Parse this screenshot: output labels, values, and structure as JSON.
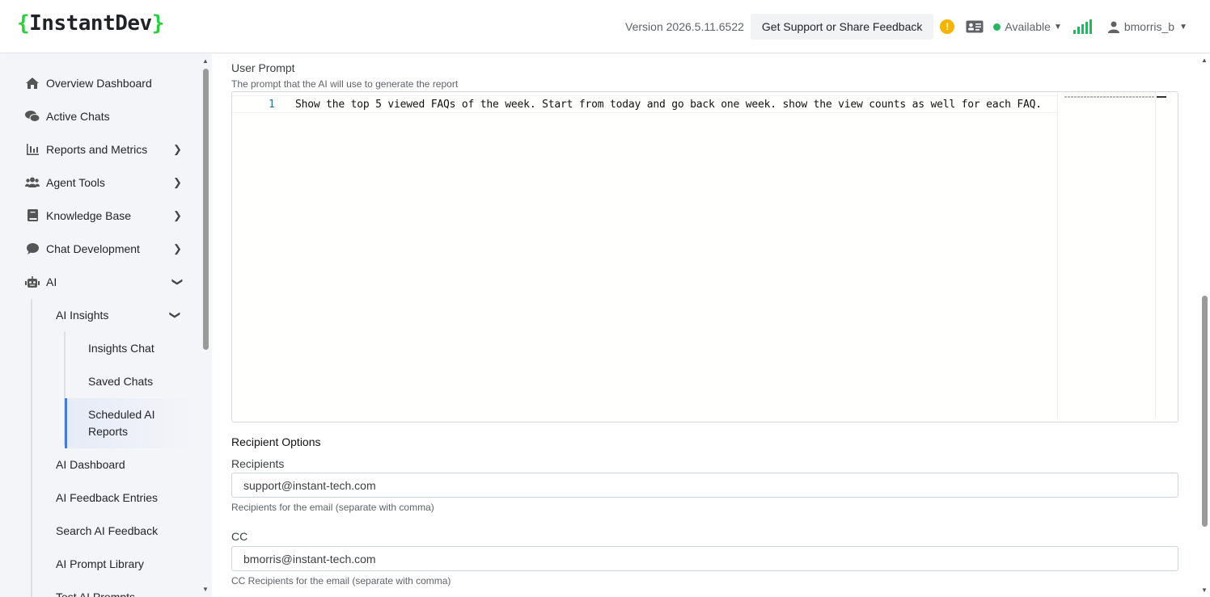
{
  "header": {
    "logo_open": "{",
    "logo_text": "InstantDev",
    "logo_close": "}",
    "version": "Version 2026.5.11.6522",
    "support_button": "Get Support or Share Feedback",
    "alert_glyph": "!",
    "status": "Available",
    "username": "bmorris_b"
  },
  "sidebar": {
    "items": [
      {
        "label": "Overview Dashboard",
        "icon": "home-icon"
      },
      {
        "label": "Active Chats",
        "icon": "chats-icon"
      },
      {
        "label": "Reports and Metrics",
        "icon": "chart-icon"
      },
      {
        "label": "Agent Tools",
        "icon": "users-icon"
      },
      {
        "label": "Knowledge Base",
        "icon": "book-icon"
      },
      {
        "label": "Chat Development",
        "icon": "chat-bubble-icon"
      },
      {
        "label": "AI",
        "icon": "robot-icon"
      }
    ],
    "ai_sub": {
      "insights": "AI Insights",
      "insights_children": [
        "Insights Chat",
        "Saved Chats",
        "Scheduled AI Reports"
      ],
      "others": [
        "AI Dashboard",
        "AI Feedback Entries",
        "Search AI Feedback",
        "AI Prompt Library",
        "Test AI Prompts"
      ]
    }
  },
  "form": {
    "user_prompt_label": "User Prompt",
    "user_prompt_hint": "The prompt that the AI will use to generate the report",
    "line_number": "1",
    "prompt_text": "Show the top 5 viewed FAQs of the week. Start from today and go back one week. show the view counts as well for each FAQ.",
    "recipient_section": "Recipient Options",
    "recipients_label": "Recipients",
    "recipients_value": "support@instant-tech.com",
    "recipients_hint": "Recipients for the email (separate with comma)",
    "cc_label": "CC",
    "cc_value": "bmorris@instant-tech.com",
    "cc_hint": "CC Recipients for the email (separate with comma)"
  },
  "colors": {
    "accent": "#4a7bd0",
    "brand_green": "#2ecc40",
    "status_green": "#28b463",
    "alert": "#f5b400"
  }
}
